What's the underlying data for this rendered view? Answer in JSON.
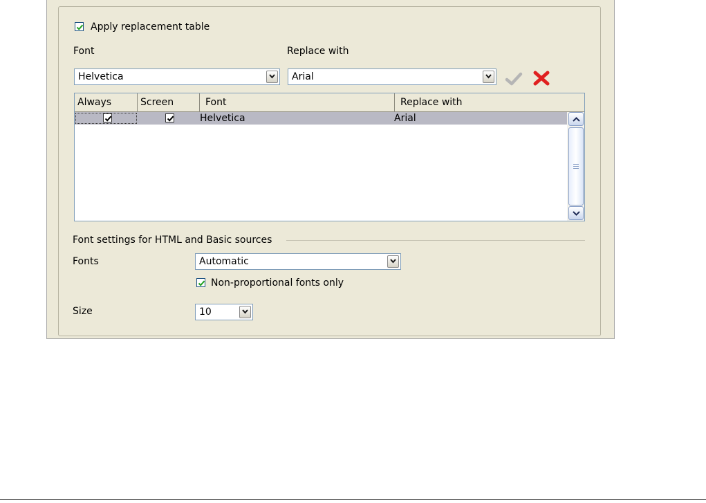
{
  "replacement": {
    "apply_label": "Apply replacement table",
    "apply_checked": true,
    "font_label": "Font",
    "replace_label": "Replace with",
    "font_value": "Helvetica",
    "replace_value": "Arial"
  },
  "table": {
    "columns": [
      "Always",
      "Screen",
      "Font",
      "Replace with"
    ],
    "rows": [
      {
        "always": true,
        "screen": true,
        "font": "Helvetica",
        "replace_with": "Arial"
      }
    ]
  },
  "sources": {
    "section_label": "Font settings for HTML and Basic sources",
    "fonts_label": "Fonts",
    "fonts_value": "Automatic",
    "nonprop_label": "Non-proportional fonts only",
    "nonprop_checked": true,
    "size_label": "Size",
    "size_value": "10"
  },
  "icons": {
    "apply": "checkmark-icon",
    "delete": "delete-x-icon",
    "accent_green": "#2e8b2e",
    "delete_red": "#e02020"
  }
}
